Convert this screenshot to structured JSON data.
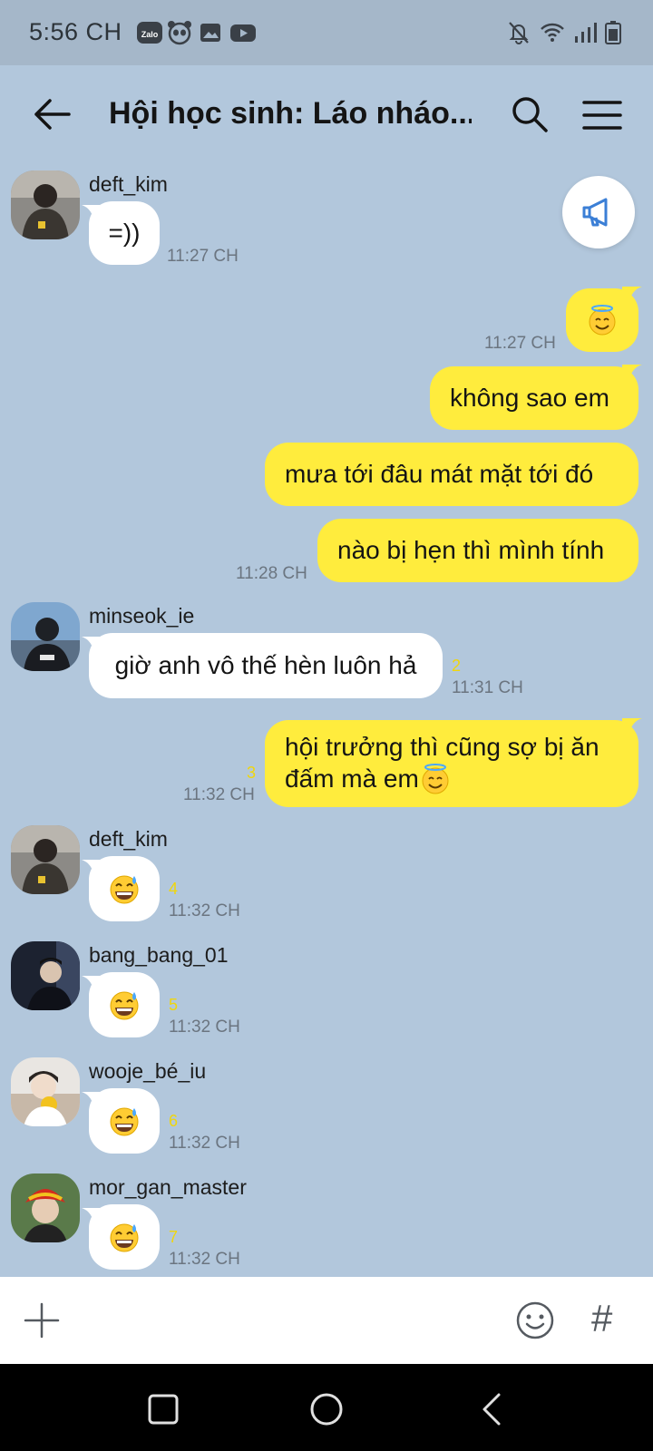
{
  "status_bar": {
    "time": "5:56 CH",
    "notification_icons": [
      "zalo-icon",
      "panda-icon",
      "gallery-icon",
      "youtube-icon"
    ],
    "zalo_label": "Zalo",
    "system_icons": [
      "bell-off-icon",
      "wifi-icon",
      "signal-icon",
      "battery-icon"
    ]
  },
  "header": {
    "title": "Hội học sinh: Láo nháo..."
  },
  "colors": {
    "background": "#b2c7dc",
    "outgoing_bubble": "#ffec3d",
    "incoming_bubble": "#ffffff",
    "read_count": "#f0d60c"
  },
  "messages": [
    {
      "direction": "in",
      "sender": "deft_kim",
      "text": "=))",
      "time": "11:27 CH"
    },
    {
      "direction": "out",
      "emoji": "smiling-face-with-halo",
      "time": "11:27 CH"
    },
    {
      "direction": "out",
      "text": "không sao em"
    },
    {
      "direction": "out",
      "text": "mưa tới đâu mát mặt tới đó"
    },
    {
      "direction": "out",
      "text": "nào bị hẹn thì mình tính",
      "time": "11:28 CH"
    },
    {
      "direction": "in",
      "sender": "minseok_ie",
      "text": "giờ anh vô thế hèn luôn hả",
      "count": "2",
      "time": "11:31 CH"
    },
    {
      "direction": "out",
      "lines": [
        "hội trưởng thì cũng sợ bị ăn",
        "đấm mà em"
      ],
      "emoji": "smiling-face-with-halo",
      "count": "3",
      "time": "11:32 CH"
    },
    {
      "direction": "in",
      "sender": "deft_kim",
      "emoji": "grinning-sweat",
      "count": "4",
      "time": "11:32 CH"
    },
    {
      "direction": "in",
      "sender": "bang_bang_01",
      "emoji": "grinning-sweat",
      "count": "5",
      "time": "11:32 CH"
    },
    {
      "direction": "in",
      "sender": "wooje_bé_iu",
      "emoji": "grinning-sweat",
      "count": "6",
      "time": "11:32 CH"
    },
    {
      "direction": "in",
      "sender": "mor_gan_master",
      "emoji": "grinning-sweat",
      "count": "7",
      "time": "11:32 CH"
    }
  ],
  "input_bar": {
    "hash_label": "#"
  },
  "nav_bar": {
    "buttons": [
      "recents-button",
      "home-button",
      "back-button"
    ]
  }
}
